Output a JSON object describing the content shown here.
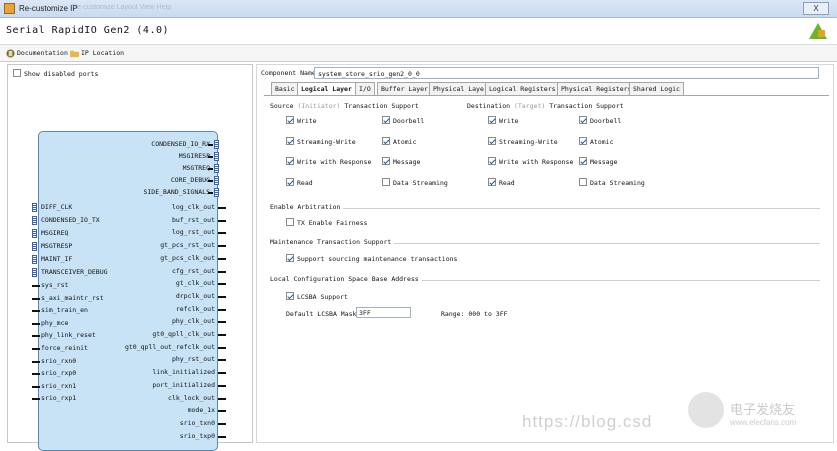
{
  "window": {
    "title": "Re-customize IP",
    "ghost_menu": "Re-customize  Layout  View  Help",
    "close_label": "X"
  },
  "header": {
    "title": "Serial RapidIO Gen2 (4.0)"
  },
  "toolbar": {
    "documentation": "Documentation",
    "ip_location": "IP Location"
  },
  "left": {
    "show_disabled": "Show disabled ports",
    "right_bus_ports": [
      "CONDENSED_IO_RX",
      "MSGIRESP",
      "MSGTREQ",
      "CORE_DEBUG",
      "SIDE_BAND_SIGNALS"
    ],
    "left_bus_ports": [
      "DIFF_CLK",
      "CONDENSED_IO_TX",
      "MSGIREQ",
      "MSGTRESP",
      "MAINT_IF",
      "TRANSCEIVER_DEBUG"
    ],
    "left_ports": [
      "sys_rst",
      "s_axi_maintr_rst",
      "sim_train_en",
      "phy_mce",
      "phy_link_reset",
      "force_reinit",
      "srio_rxn0",
      "srio_rxp0",
      "srio_rxn1",
      "srio_rxp1"
    ],
    "right_ports": [
      "log_clk_out",
      "buf_rst_out",
      "log_rst_out",
      "gt_pcs_rst_out",
      "gt_pcs_clk_out",
      "cfg_rst_out",
      "gt_clk_out",
      "drpclk_out",
      "refclk_out",
      "phy_clk_out",
      "gt0_qpll_clk_out",
      "gt0_qpll_out_refclk_out",
      "phy_rst_out",
      "link_initialized",
      "port_initialized",
      "clk_lock_out",
      "mode_1x",
      "srio_txn0",
      "srio_txp0"
    ]
  },
  "right": {
    "component_name_label": "Component Name",
    "component_name_value": "system_store_srio_gen2_0_0",
    "tabs": [
      "Basic",
      "Logical Layer",
      "I/O",
      "Buffer Layer",
      "Physical Layer",
      "Logical Registers",
      "Physical Registers",
      "Shared Logic"
    ],
    "active_tab": "Logical Layer",
    "source": {
      "prefix": "Source ",
      "dim": "(Initiator)",
      "suffix": " Transaction Support"
    },
    "dest": {
      "prefix": "Destination ",
      "dim": "(Target)",
      "suffix": " Transaction Support"
    },
    "src_col1": [
      {
        "label": "Write",
        "on": true
      },
      {
        "label": "Streaming-Write",
        "on": true
      },
      {
        "label": "Write with Response",
        "on": true
      },
      {
        "label": "Read",
        "on": true
      }
    ],
    "src_col2": [
      {
        "label": "Doorbell",
        "on": true
      },
      {
        "label": "Atomic",
        "on": true
      },
      {
        "label": "Message",
        "on": true
      },
      {
        "label": "Data Streaming",
        "on": false
      }
    ],
    "dst_col1": [
      {
        "label": "Write",
        "on": true
      },
      {
        "label": "Streaming-Write",
        "on": true
      },
      {
        "label": "Write with Response",
        "on": true
      },
      {
        "label": "Read",
        "on": true
      }
    ],
    "dst_col2": [
      {
        "label": "Doorbell",
        "on": true
      },
      {
        "label": "Atomic",
        "on": true
      },
      {
        "label": "Message",
        "on": true
      },
      {
        "label": "Data Streaming",
        "on": false
      }
    ],
    "arb_title": "Enable Arbitration",
    "arb_opt": "TX Enable Fairness",
    "maint_title": "Maintenance Transaction Support",
    "maint_opt": "Support sourcing maintenance transactions",
    "lcs_title": "Local Configuration Space Base Address",
    "lcs_opt": "LCSBA Support",
    "mask_label": "Default LCSBA Mask",
    "mask_value": "3FF",
    "range": "Range: 000 to 3FF"
  },
  "watermark": {
    "url": "https://blog.csd",
    "brand": "电子发烧友",
    "site": "www.elecfans.com"
  }
}
